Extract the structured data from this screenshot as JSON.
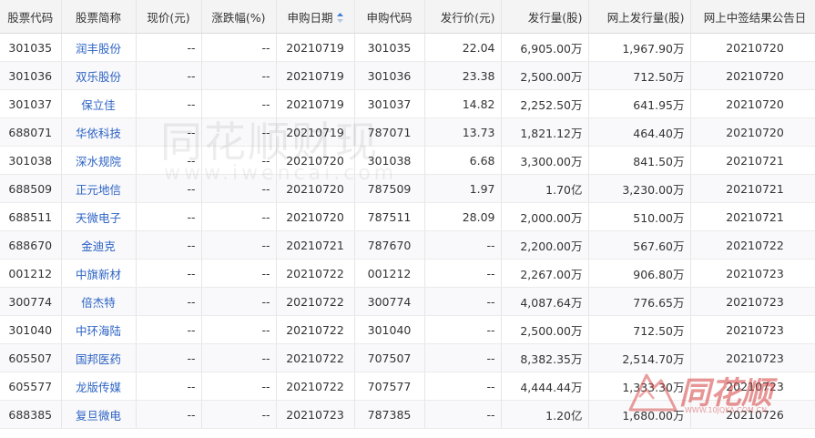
{
  "table": {
    "columns": [
      "股票代码",
      "股票简称",
      "现价(元)",
      "涨跌幅(%)",
      "申购日期",
      "申购代码",
      "发行价(元)",
      "发行量(股)",
      "网上发行量(股)",
      "网上中签结果公告日"
    ],
    "sorted_column": "申购日期",
    "rows": [
      {
        "code": "301035",
        "name": "润丰股份",
        "price": "--",
        "change": "--",
        "date": "20210719",
        "sub_code": "301035",
        "issue_price": "22.04",
        "issue_vol": "6,905.00万",
        "online_vol": "1,967.90万",
        "result_date": "20210720"
      },
      {
        "code": "301036",
        "name": "双乐股份",
        "price": "--",
        "change": "--",
        "date": "20210719",
        "sub_code": "301036",
        "issue_price": "23.38",
        "issue_vol": "2,500.00万",
        "online_vol": "712.50万",
        "result_date": "20210720"
      },
      {
        "code": "301037",
        "name": "保立佳",
        "price": "--",
        "change": "--",
        "date": "20210719",
        "sub_code": "301037",
        "issue_price": "14.82",
        "issue_vol": "2,252.50万",
        "online_vol": "641.95万",
        "result_date": "20210720"
      },
      {
        "code": "688071",
        "name": "华依科技",
        "price": "--",
        "change": "--",
        "date": "20210719",
        "sub_code": "787071",
        "issue_price": "13.73",
        "issue_vol": "1,821.12万",
        "online_vol": "464.40万",
        "result_date": "20210720"
      },
      {
        "code": "301038",
        "name": "深水规院",
        "price": "--",
        "change": "--",
        "date": "20210720",
        "sub_code": "301038",
        "issue_price": "6.68",
        "issue_vol": "3,300.00万",
        "online_vol": "841.50万",
        "result_date": "20210721"
      },
      {
        "code": "688509",
        "name": "正元地信",
        "price": "--",
        "change": "--",
        "date": "20210720",
        "sub_code": "787509",
        "issue_price": "1.97",
        "issue_vol": "1.70亿",
        "online_vol": "3,230.00万",
        "result_date": "20210721"
      },
      {
        "code": "688511",
        "name": "天微电子",
        "price": "--",
        "change": "--",
        "date": "20210720",
        "sub_code": "787511",
        "issue_price": "28.09",
        "issue_vol": "2,000.00万",
        "online_vol": "510.00万",
        "result_date": "20210721"
      },
      {
        "code": "688670",
        "name": "金迪克",
        "price": "--",
        "change": "--",
        "date": "20210721",
        "sub_code": "787670",
        "issue_price": "--",
        "issue_vol": "2,200.00万",
        "online_vol": "567.60万",
        "result_date": "20210722"
      },
      {
        "code": "001212",
        "name": "中旗新材",
        "price": "--",
        "change": "--",
        "date": "20210722",
        "sub_code": "001212",
        "issue_price": "--",
        "issue_vol": "2,267.00万",
        "online_vol": "906.80万",
        "result_date": "20210723"
      },
      {
        "code": "300774",
        "name": "倍杰特",
        "price": "--",
        "change": "--",
        "date": "20210722",
        "sub_code": "300774",
        "issue_price": "--",
        "issue_vol": "4,087.64万",
        "online_vol": "776.65万",
        "result_date": "20210723"
      },
      {
        "code": "301040",
        "name": "中环海陆",
        "price": "--",
        "change": "--",
        "date": "20210722",
        "sub_code": "301040",
        "issue_price": "--",
        "issue_vol": "2,500.00万",
        "online_vol": "712.50万",
        "result_date": "20210723"
      },
      {
        "code": "605507",
        "name": "国邦医药",
        "price": "--",
        "change": "--",
        "date": "20210722",
        "sub_code": "707507",
        "issue_price": "--",
        "issue_vol": "8,382.35万",
        "online_vol": "2,514.70万",
        "result_date": "20210723"
      },
      {
        "code": "605577",
        "name": "龙版传媒",
        "price": "--",
        "change": "--",
        "date": "20210722",
        "sub_code": "707577",
        "issue_price": "--",
        "issue_vol": "4,444.44万",
        "online_vol": "1,333.30万",
        "result_date": "20210723"
      },
      {
        "code": "688385",
        "name": "复旦微电",
        "price": "--",
        "change": "--",
        "date": "20210723",
        "sub_code": "787385",
        "issue_price": "--",
        "issue_vol": "1.20亿",
        "online_vol": "1,680.00万",
        "result_date": "20210726"
      }
    ]
  },
  "watermark": {
    "text": "同花顺财现",
    "url": "www.iwencai.com"
  },
  "logo": {
    "text": "同花顺",
    "url": "WWW.10JQKA.COM.CN",
    "color": "#d63e3e"
  },
  "colors": {
    "link": "#2c63c4",
    "header_bg": "#f4f4f4",
    "sort_arrow": "#3f7fd6"
  },
  "icons": [
    "sort-icon",
    "tonghuashun-logo-icon"
  ]
}
